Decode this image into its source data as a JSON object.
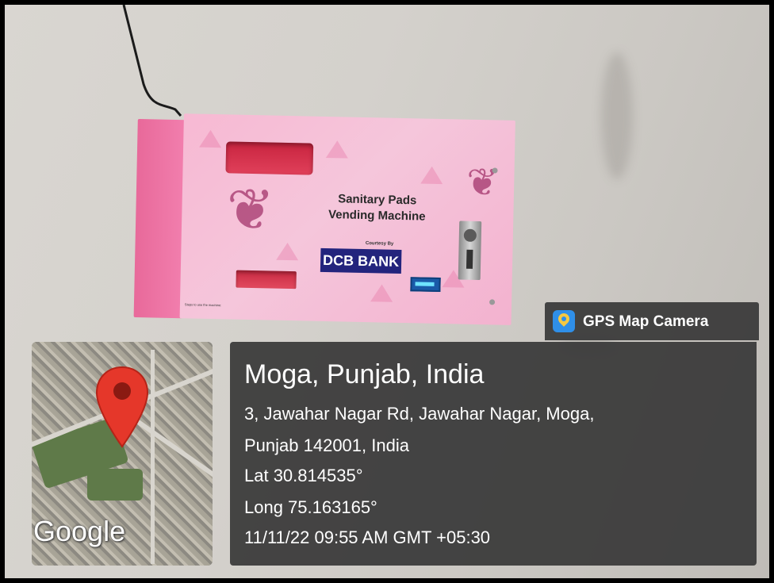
{
  "photo": {
    "machine": {
      "title_line1": "Sanitary Pads",
      "title_line2": "Vending Machine",
      "courtesy": "Courtesy By",
      "sponsor": "DCB BANK",
      "fine_print": "Steps to use the machine:"
    }
  },
  "overlay": {
    "brand": "GPS Map Camera",
    "map_label": "Google",
    "location_title": "Moga, Punjab, India",
    "address_line1": "3, Jawahar Nagar Rd, Jawahar Nagar, Moga,",
    "address_line2": "Punjab 142001, India",
    "latitude": "Lat 30.814535°",
    "longitude": "Long 75.163165°",
    "timestamp": "11/11/22 09:55 AM GMT +05:30"
  },
  "colors": {
    "frame": "#000000",
    "overlay_bg": "#373737",
    "pin": "#e5372a",
    "machine_pink": "#f5c6db",
    "sponsor_blue": "#23247d"
  }
}
